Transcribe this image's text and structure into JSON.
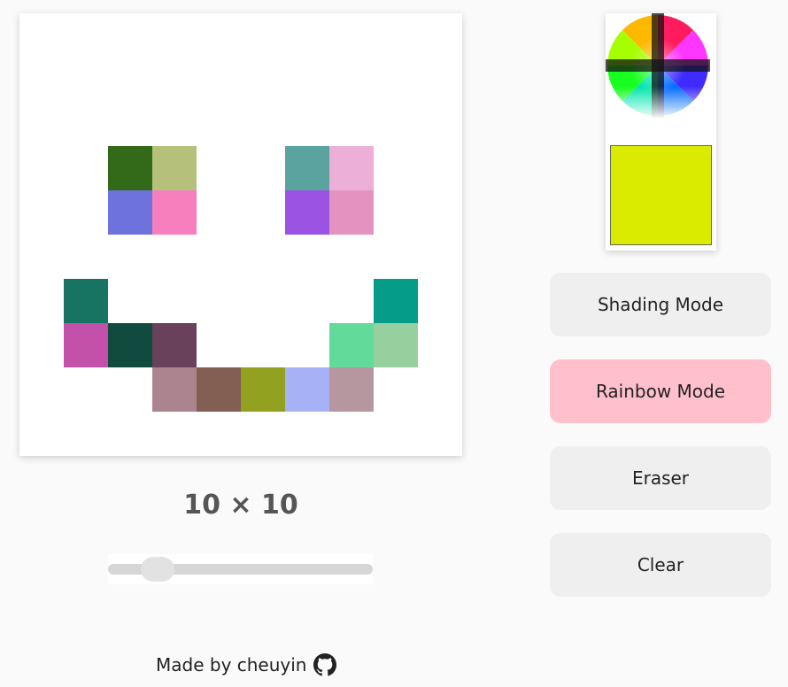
{
  "grid": {
    "size_label": "10 × 10",
    "cells": [
      [
        "",
        "",
        "",
        "",
        "",
        "",
        "",
        "",
        "",
        ""
      ],
      [
        "",
        "",
        "",
        "",
        "",
        "",
        "",
        "",
        "",
        ""
      ],
      [
        "",
        "",
        "",
        "",
        "",
        "",
        "",
        "",
        "",
        ""
      ],
      [
        "",
        "",
        "#326a19",
        "#b5c07b",
        "",
        "",
        "#5aa39f",
        "#ebafd8",
        "",
        ""
      ],
      [
        "",
        "",
        "#6e72dc",
        "#f77fbe",
        "",
        "",
        "#9a53e2",
        "#e493c1",
        "",
        ""
      ],
      [
        "",
        "",
        "",
        "",
        "",
        "",
        "",
        "",
        "",
        ""
      ],
      [
        "",
        "#187462",
        "",
        "",
        "",
        "",
        "",
        "",
        "#069c8a",
        ""
      ],
      [
        "",
        "#c351aa",
        "#114a3f",
        "#69415b",
        "",
        "",
        "",
        "#62da99",
        "#98cf9e",
        ""
      ],
      [
        "",
        "",
        "",
        "#ab848f",
        "#825f52",
        "#93a120",
        "#a7b2f6",
        "#b7979f",
        "",
        ""
      ],
      [
        "",
        "",
        "",
        "",
        "",
        "",
        "",
        "",
        "",
        ""
      ]
    ]
  },
  "slider": {
    "value": 10,
    "min": 1,
    "max": 64
  },
  "picker": {
    "current_color": "#dbeb00"
  },
  "buttons": {
    "shading": "Shading Mode",
    "rainbow": "Rainbow Mode",
    "eraser": "Eraser",
    "clear": "Clear"
  },
  "active_mode": "rainbow",
  "footer": {
    "text": "Made by cheuyin",
    "icon": "github-icon"
  },
  "colors": {
    "active_button": "#ffc0cb",
    "button": "#efefef"
  }
}
